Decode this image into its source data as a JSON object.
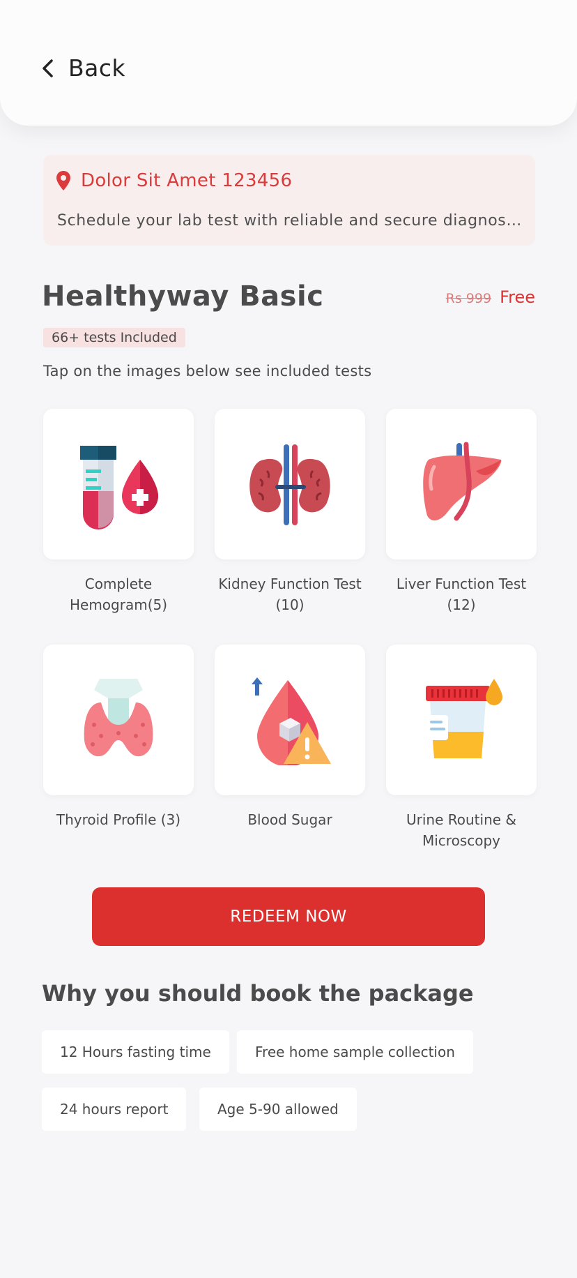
{
  "header": {
    "back_label": "Back"
  },
  "location": {
    "title": "Dolor Sit Amet 123456",
    "description": "Schedule your lab test with reliable and secure diagnostics",
    "accent_color": "#dc3b3b"
  },
  "package": {
    "name": "Healthyway Basic",
    "old_price": "Rs  999",
    "price": "Free",
    "tests_badge": "66+ tests Included",
    "tap_hint": "Tap on the images below see included tests"
  },
  "tests": [
    {
      "label": "Complete Hemogram(5)",
      "icon": "blood-test-icon"
    },
    {
      "label": "Kidney Function Test (10)",
      "icon": "kidney-icon"
    },
    {
      "label": "Liver Function Test (12)",
      "icon": "liver-icon"
    },
    {
      "label": "Thyroid Profile (3)",
      "icon": "thyroid-icon"
    },
    {
      "label": "Blood Sugar",
      "icon": "blood-sugar-icon"
    },
    {
      "label": "Urine Routine & Microscopy",
      "icon": "urine-sample-icon"
    }
  ],
  "cta": {
    "label": "REDEEM NOW",
    "color": "#dc302e"
  },
  "why": {
    "title": "Why you should book the package",
    "chips": [
      "12 Hours fasting time",
      "Free home sample collection",
      "24 hours report",
      "Age 5-90 allowed"
    ]
  }
}
